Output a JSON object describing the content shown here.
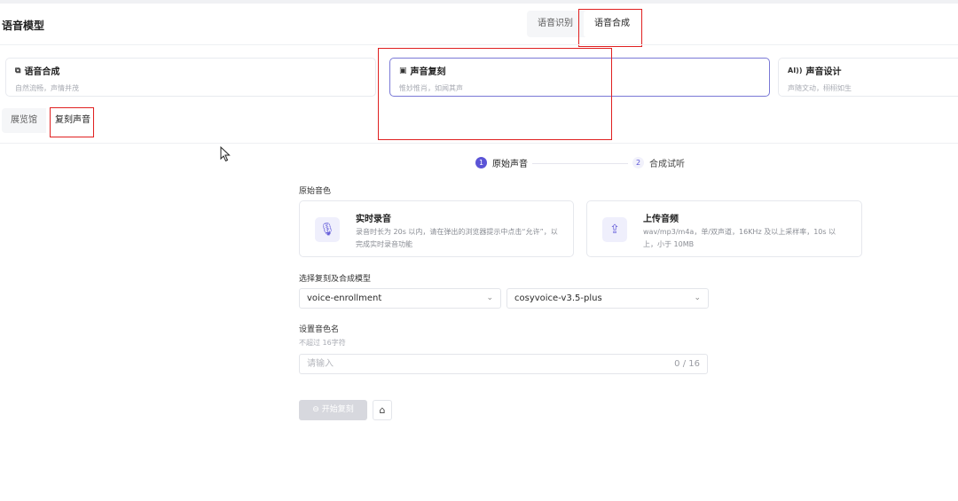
{
  "header": {
    "title": "语音模型"
  },
  "top_tabs": [
    {
      "label": "语音识别"
    },
    {
      "label": "语音合成"
    }
  ],
  "cards": [
    {
      "icon": "speech-synthesis-icon",
      "title": "语音合成",
      "desc": "自然流畅，声情并茂"
    },
    {
      "icon": "voice-clone-icon",
      "title": "声音复刻",
      "desc": "惟妙惟肖，如闻其声"
    },
    {
      "icon": "ai-voice-design-icon",
      "icon_text": "AI))",
      "title": "声音设计",
      "desc": "声随文动，栩栩如生"
    }
  ],
  "sub_tabs": [
    {
      "label": "展览馆"
    },
    {
      "label": "复刻声音"
    }
  ],
  "steps": [
    {
      "num": "1",
      "label": "原始声音"
    },
    {
      "num": "2",
      "label": "合成试听"
    }
  ],
  "source": {
    "label": "原始音色",
    "record": {
      "title": "实时录音",
      "desc": "录音时长为 20s 以内，请在弹出的浏览器提示中点击“允许”，以完成实时录音功能"
    },
    "upload": {
      "title": "上传音频",
      "desc": "wav/mp3/m4a，单/双声道，16KHz 及以上采样率，10s 以上，小于 10MB"
    }
  },
  "model": {
    "label": "选择复刻及合成模型",
    "enroll_value": "voice-enrollment",
    "synth_value": "cosyvoice-v3.5-plus"
  },
  "voice_name": {
    "label": "设置音色名",
    "hint": "不超过 16字符",
    "placeholder": "请输入",
    "counter": "0 / 16"
  },
  "actions": {
    "start_label": "开始复刻"
  },
  "colors": {
    "accent": "#5b54d6",
    "highlight": "#e02020"
  }
}
